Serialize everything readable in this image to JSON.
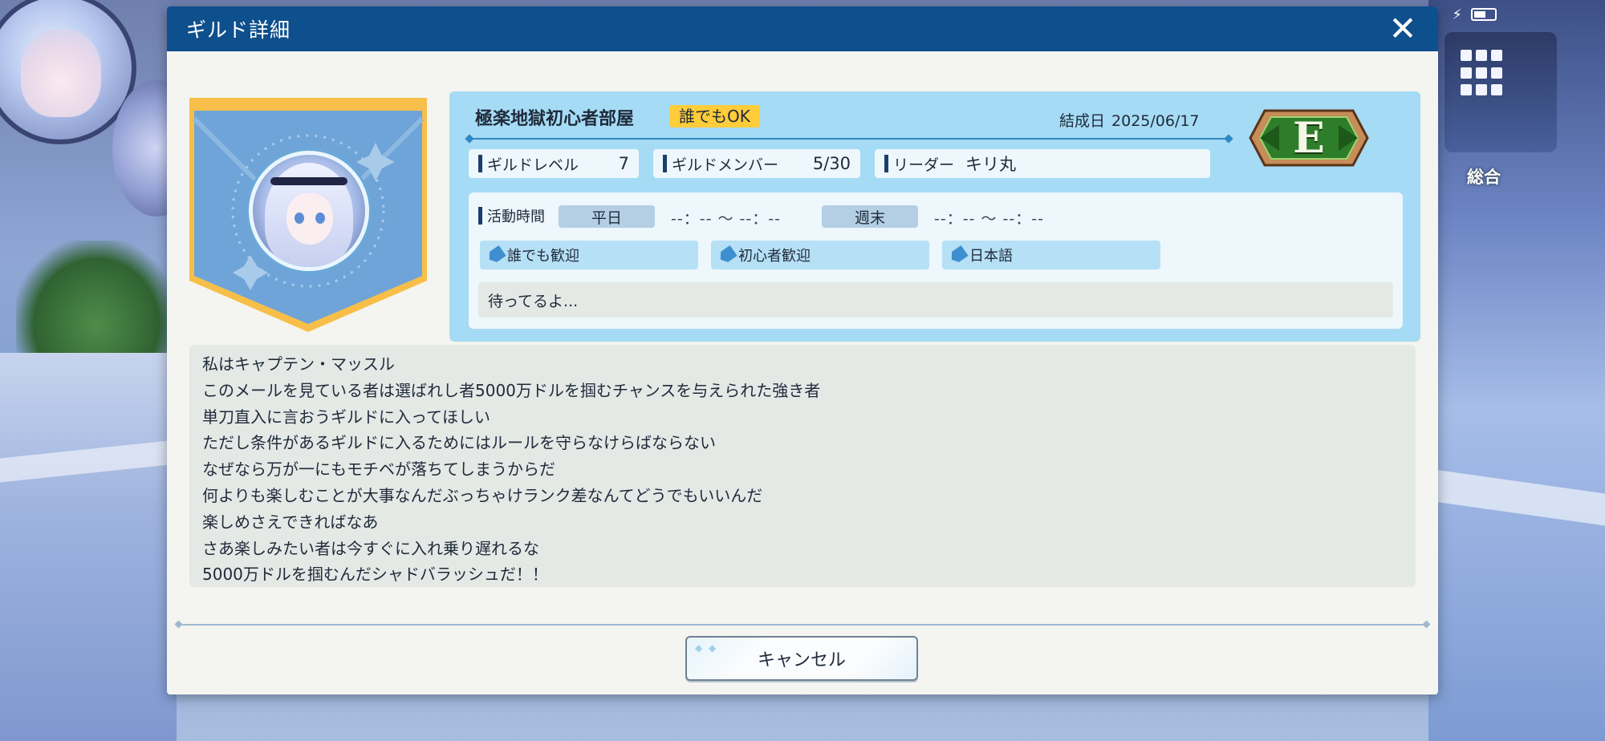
{
  "dialog": {
    "title": "ギルド詳細",
    "close_icon": "close-icon"
  },
  "guild": {
    "name": "極楽地獄初心者部屋",
    "badge": "誰でもOK",
    "founded_label": "結成日",
    "founded_date": "2025/06/17",
    "rank": "E",
    "banner_icon": "guild-banner-icon",
    "colors": {
      "header": "#0e4f8d",
      "panel": "#a5dbf5",
      "badge": "#ffcc3a",
      "banner": "#6fa4d8",
      "banner_trim": "#f7bf49",
      "rank_green": "#2e7d2a"
    }
  },
  "stats": {
    "level_label": "ギルドレベル",
    "level_value": "7",
    "members_label": "ギルドメンバー",
    "members_value": "5/30",
    "leader_label": "リーダー",
    "leader_value": "キリ丸"
  },
  "activity": {
    "label": "活動時間",
    "weekday_label": "平日",
    "weekday_time": "--：-- 〜 --：--",
    "weekend_label": "週末",
    "weekend_time": "--：-- 〜 --：--",
    "tags": [
      "誰でも歓迎",
      "初心者歓迎",
      "日本語"
    ],
    "message": "待ってるよ..."
  },
  "description": {
    "lines": [
      "私はキャプテン・マッスル",
      "このメールを見ている者は選ばれし者5000万ドルを掴むチャンスを与えられた強き者",
      "単刀直入に言おうギルドに入ってほしい",
      "ただし条件があるギルドに入るためにはルールを守らなけらばならない",
      "なぜなら万が一にもモチベが落ちてしまうからだ",
      "何よりも楽しむことが大事なんだぶっちゃけランク差なんてどうでもいいんだ",
      "楽しめさえできればなあ",
      "さあ楽しみたい者は今すぐに入れ乗り遅れるな",
      "5000万ドルを掴むんだシャドバラッシュだ！！"
    ]
  },
  "footer": {
    "cancel_label": "キャンセル"
  },
  "background": {
    "right_label": "総合"
  }
}
